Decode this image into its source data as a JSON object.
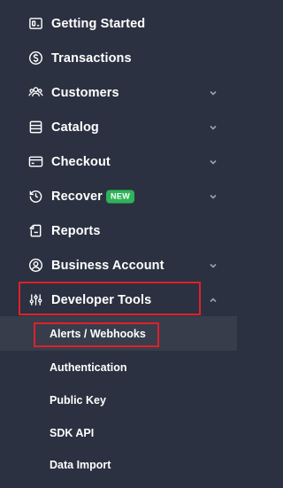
{
  "nav": {
    "items": [
      {
        "label": "Getting Started",
        "icon": "getting-started-icon",
        "has_chevron": false
      },
      {
        "label": "Transactions",
        "icon": "dollar-circle-icon",
        "has_chevron": false
      },
      {
        "label": "Customers",
        "icon": "customers-icon",
        "has_chevron": true
      },
      {
        "label": "Catalog",
        "icon": "catalog-icon",
        "has_chevron": true
      },
      {
        "label": "Checkout",
        "icon": "credit-card-icon",
        "has_chevron": true
      },
      {
        "label": "Recover",
        "icon": "recover-icon",
        "has_chevron": true,
        "badge": "NEW"
      },
      {
        "label": "Reports",
        "icon": "reports-icon",
        "has_chevron": false
      },
      {
        "label": "Business Account",
        "icon": "user-circle-icon",
        "has_chevron": true
      },
      {
        "label": "Developer Tools",
        "icon": "sliders-icon",
        "has_chevron": true,
        "expanded": true
      }
    ]
  },
  "developer_tools": {
    "sub_items": [
      {
        "label": "Alerts / Webhooks",
        "active": true
      },
      {
        "label": "Authentication"
      },
      {
        "label": "Public Key"
      },
      {
        "label": "SDK API"
      },
      {
        "label": "Data Import"
      }
    ]
  },
  "colors": {
    "background": "#2b3140",
    "active_row": "#373d4b",
    "highlight_border": "#e0202b",
    "badge_green": "#2fb35a",
    "chevron": "#9aa0ab"
  }
}
